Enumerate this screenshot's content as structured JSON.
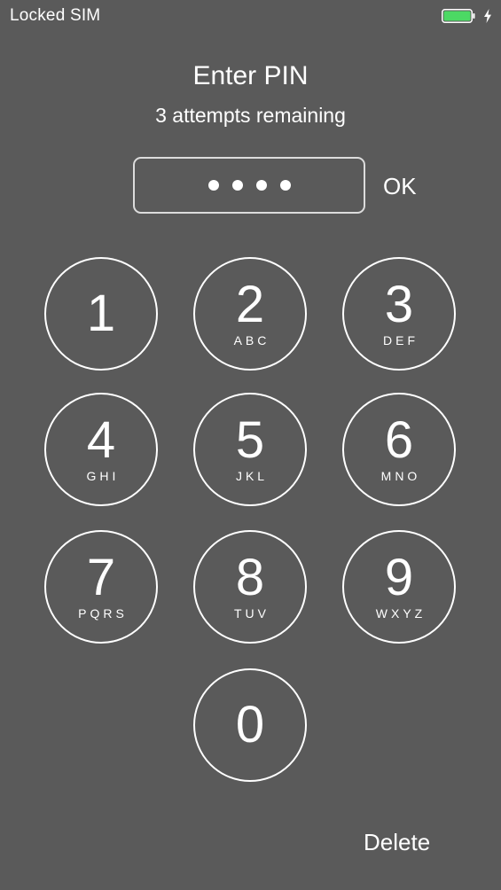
{
  "status_bar": {
    "carrier": "Locked SIM",
    "battery_level": 1.0,
    "battery_color": "#4cd964",
    "charging_icon": "lightning-bolt-icon"
  },
  "prompt": {
    "title": "Enter PIN",
    "subtitle": "3 attempts remaining"
  },
  "pin_field": {
    "entered_digits": 4,
    "masked_value": "••••"
  },
  "ok_label": "OK",
  "delete_label": "Delete",
  "keypad": [
    {
      "digit": "1",
      "letters": ""
    },
    {
      "digit": "2",
      "letters": "ABC"
    },
    {
      "digit": "3",
      "letters": "DEF"
    },
    {
      "digit": "4",
      "letters": "GHI"
    },
    {
      "digit": "5",
      "letters": "JKL"
    },
    {
      "digit": "6",
      "letters": "MNO"
    },
    {
      "digit": "7",
      "letters": "PQRS"
    },
    {
      "digit": "8",
      "letters": "TUV"
    },
    {
      "digit": "9",
      "letters": "WXYZ"
    },
    {
      "digit": "0",
      "letters": ""
    }
  ],
  "colors": {
    "background": "#5a5a5a",
    "foreground": "#ffffff"
  }
}
